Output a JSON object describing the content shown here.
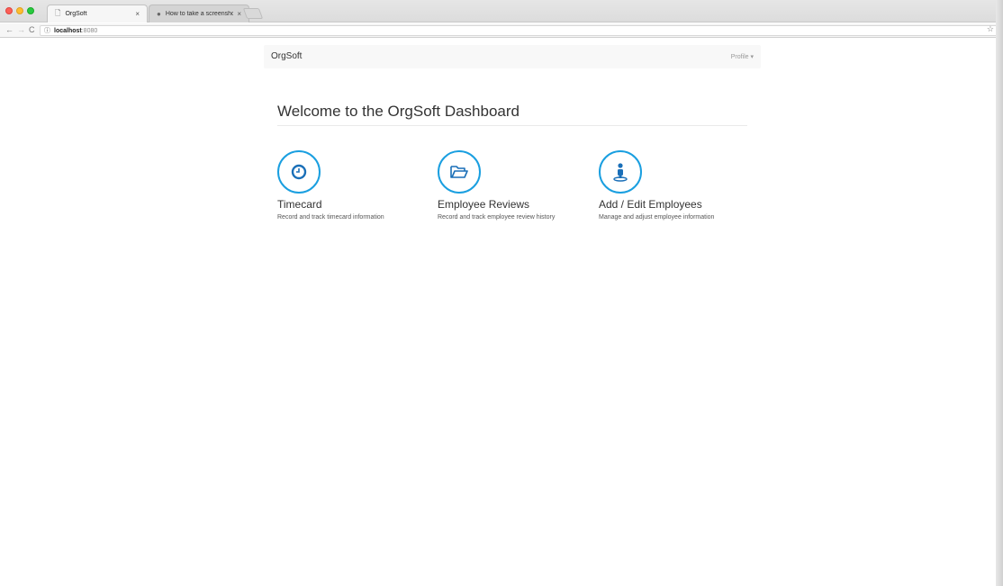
{
  "browser": {
    "tabs": [
      {
        "label": "OrgSoft",
        "icon": "page-icon",
        "close": "×"
      },
      {
        "label": "How to take a screenshot on ",
        "icon": "apple-icon",
        "close": "×"
      }
    ],
    "url_host": "localhost",
    "url_port": ":8080"
  },
  "navbar": {
    "brand": "OrgSoft",
    "profile": "Profile ▾"
  },
  "main": {
    "heading": "Welcome to the OrgSoft Dashboard",
    "features": [
      {
        "title": "Timecard",
        "desc": "Record and track timecard information",
        "icon": "clock-icon"
      },
      {
        "title": "Employee Reviews",
        "desc": "Record and track employee review history",
        "icon": "folder-open-icon"
      },
      {
        "title": "Add / Edit Employees",
        "desc": "Manage and adjust employee information",
        "icon": "user-icon"
      }
    ]
  },
  "colors": {
    "accent": "#1a9fe0",
    "icon": "#1a6fb8"
  }
}
